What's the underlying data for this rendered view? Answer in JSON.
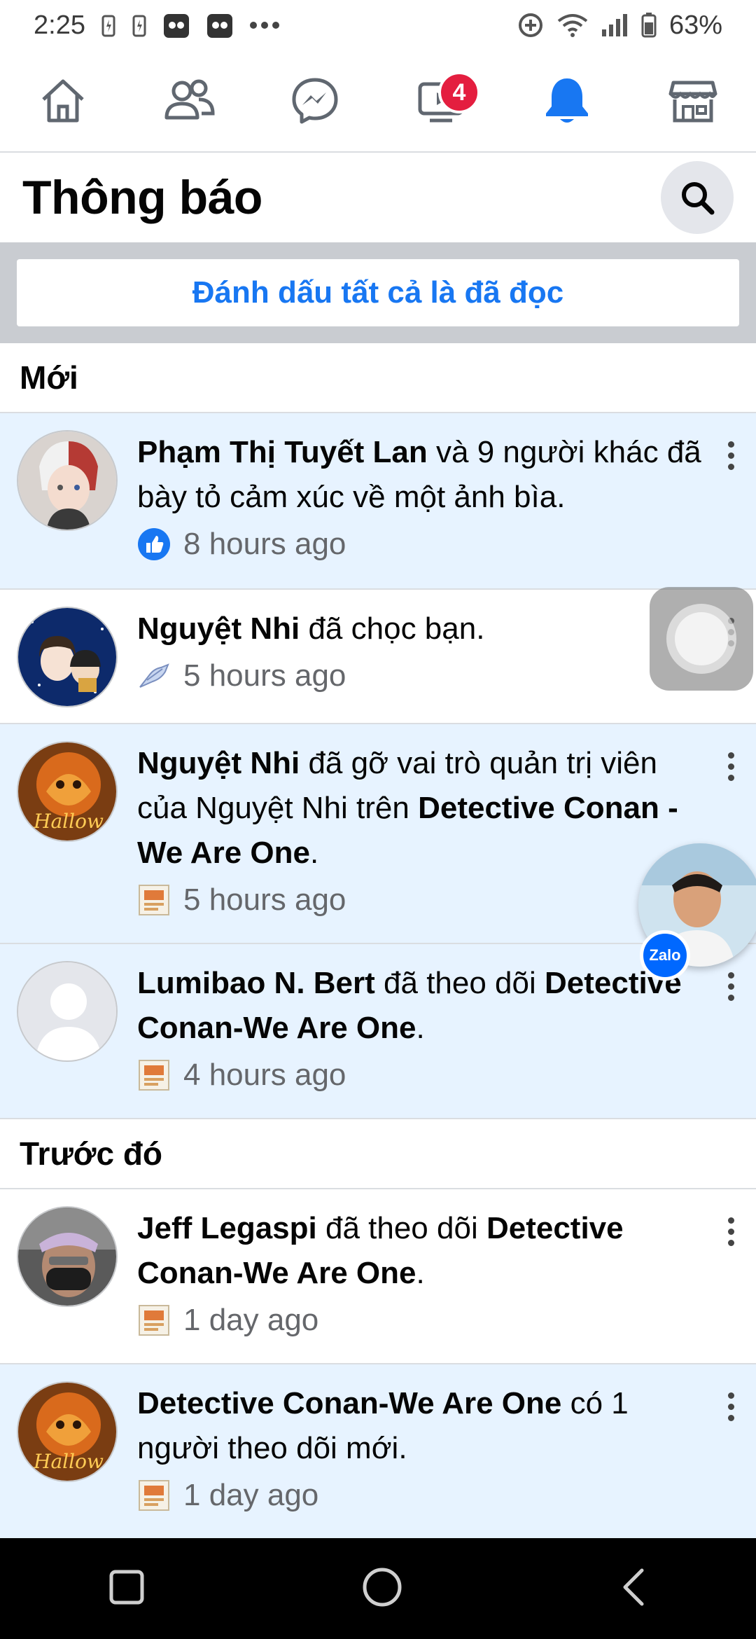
{
  "status_bar": {
    "time": "2:25",
    "battery": "63%"
  },
  "nav": {
    "items": [
      {
        "icon": "home-icon"
      },
      {
        "icon": "friends-icon"
      },
      {
        "icon": "messenger-icon"
      },
      {
        "icon": "watch-icon",
        "badge": "4"
      },
      {
        "icon": "bell-icon",
        "active": true
      },
      {
        "icon": "marketplace-icon"
      }
    ],
    "active_color": "#1877f2",
    "badge_color": "#e41e3f"
  },
  "header": {
    "title": "Thông báo",
    "search_icon": "search-icon"
  },
  "mark_all_label": "Đánh dấu tất cả là đã đọc",
  "sections": {
    "new_title": "Mới",
    "earlier_title": "Trước đó"
  },
  "notifications": [
    {
      "actor": "Phạm Thị Tuyết Lan",
      "text": " và 9 người khác đã bày tỏ cảm xúc về một ảnh bìa.",
      "time": "8 hours ago",
      "icon": "like-icon",
      "unread": true
    },
    {
      "actor": "Nguyệt Nhi",
      "text": " đã chọc bạn.",
      "time": "5 hours ago",
      "icon": "poke-icon",
      "unread": false
    },
    {
      "actor": "Nguyệt Nhi",
      "text": " đã gỡ vai trò quản trị viên của Nguyệt Nhi trên ",
      "target": "Detective Conan -We Are One",
      "suffix": ".",
      "time": "5 hours ago",
      "icon": "page-icon",
      "unread": true
    },
    {
      "actor": "Lumibao N. Bert",
      "text": " đã theo dõi ",
      "target": "Detective Conan-We Are One",
      "suffix": ".",
      "time": "4 hours ago",
      "icon": "page-icon",
      "unread": true
    },
    {
      "actor": "Jeff Legaspi",
      "text": " đã theo dõi ",
      "target": "Detective Conan-We Are One",
      "suffix": ".",
      "time": "1 day ago",
      "icon": "page-icon",
      "unread": false
    },
    {
      "actor": "Detective Conan-We Are One",
      "text": " có 1 người theo dõi mới.",
      "time": "1 day ago",
      "icon": "page-icon",
      "unread": true
    }
  ],
  "zalo_label": "Zalo"
}
